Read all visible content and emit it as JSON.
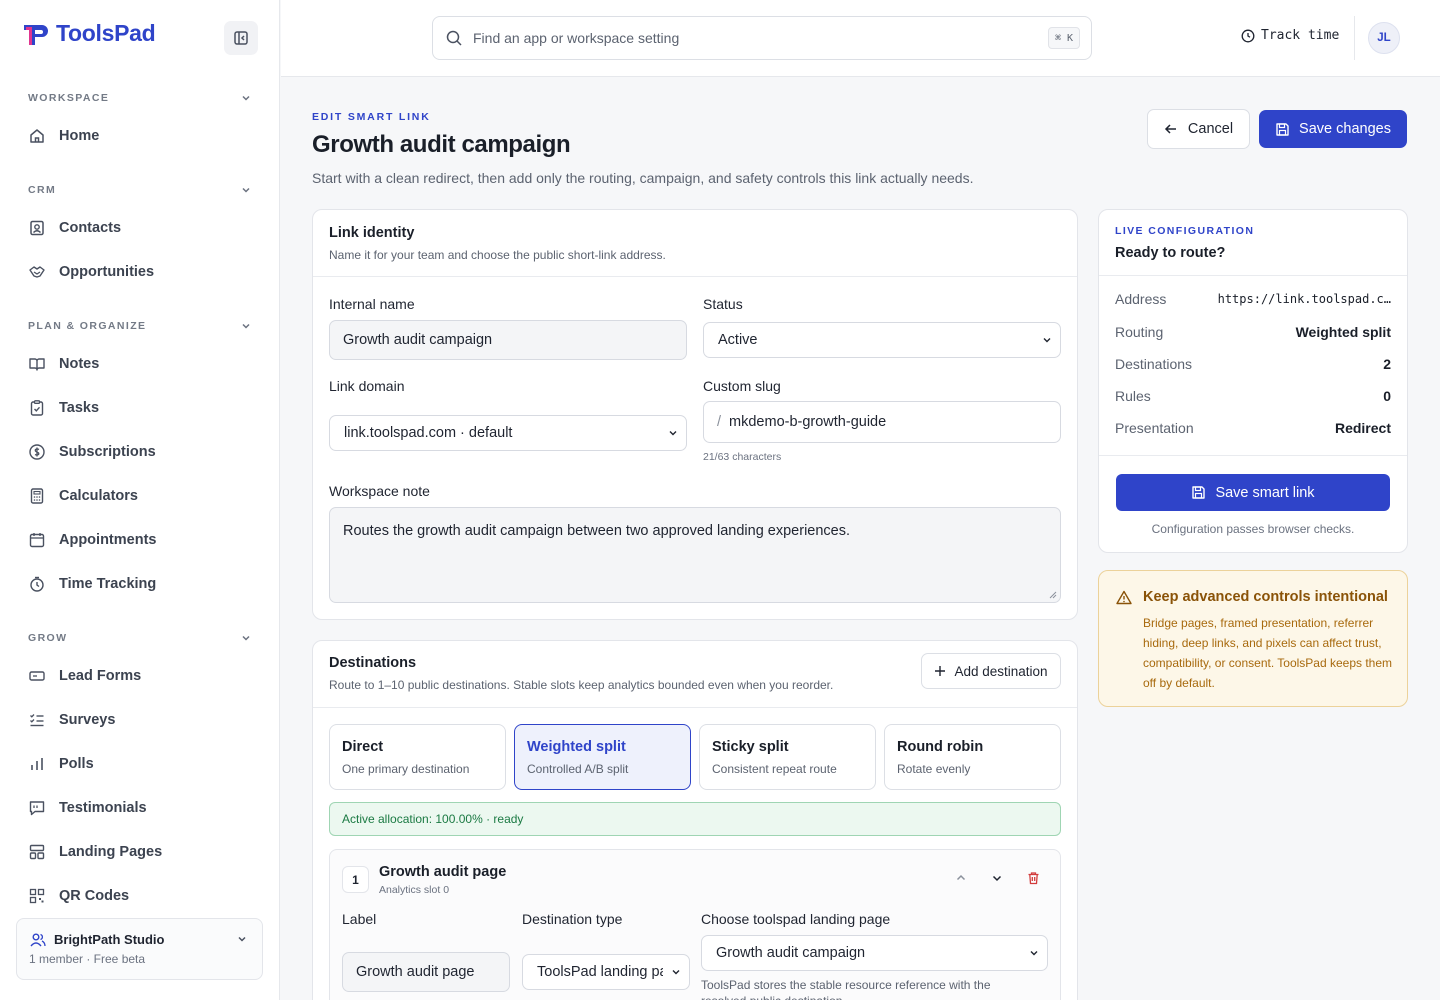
{
  "app": {
    "name": "ToolsPad",
    "brand_color": "#2f44c9"
  },
  "sidebar": {
    "sections": [
      {
        "label": "WORKSPACE",
        "items": [
          {
            "label": "Home",
            "icon": "home-icon"
          }
        ]
      },
      {
        "label": "CRM",
        "items": [
          {
            "label": "Contacts",
            "icon": "contact-card-icon"
          },
          {
            "label": "Opportunities",
            "icon": "handshake-icon"
          }
        ]
      },
      {
        "label": "PLAN & ORGANIZE",
        "items": [
          {
            "label": "Notes",
            "icon": "book-icon"
          },
          {
            "label": "Tasks",
            "icon": "clipboard-check-icon"
          },
          {
            "label": "Subscriptions",
            "icon": "dollar-circle-icon"
          },
          {
            "label": "Calculators",
            "icon": "calculator-icon"
          },
          {
            "label": "Appointments",
            "icon": "calendar-icon"
          },
          {
            "label": "Time Tracking",
            "icon": "stopwatch-icon"
          }
        ]
      },
      {
        "label": "GROW",
        "items": [
          {
            "label": "Lead Forms",
            "icon": "form-icon"
          },
          {
            "label": "Surveys",
            "icon": "checklist-icon"
          },
          {
            "label": "Polls",
            "icon": "bar-chart-icon"
          },
          {
            "label": "Testimonials",
            "icon": "message-square-icon"
          },
          {
            "label": "Landing Pages",
            "icon": "layout-icon"
          },
          {
            "label": "QR Codes",
            "icon": "qr-code-icon"
          }
        ]
      }
    ],
    "workspace": {
      "name": "BrightPath Studio",
      "meta": "1 member · Free beta"
    }
  },
  "topbar": {
    "search_placeholder": "Find an app or workspace setting",
    "shortcut": "⌘ K",
    "track_time": "Track time",
    "avatar_initials": "JL"
  },
  "page": {
    "eyebrow": "EDIT SMART LINK",
    "title": "Growth audit campaign",
    "subtitle": "Start with a clean redirect, then add only the routing, campaign, and safety controls this link actually needs.",
    "cancel_label": "Cancel",
    "save_label": "Save changes"
  },
  "identity": {
    "title": "Link identity",
    "desc": "Name it for your team and choose the public short-link address.",
    "internal_name_label": "Internal name",
    "internal_name_value": "Growth audit campaign",
    "status_label": "Status",
    "status_value": "Active",
    "domain_label": "Link domain",
    "domain_value": "link.toolspad.com · default",
    "slug_label": "Custom slug",
    "slug_prefix": "/",
    "slug_value": "mkdemo-b-growth-guide",
    "slug_hint": "21/63 characters",
    "note_label": "Workspace note",
    "note_value": "Routes the growth audit campaign between two approved landing experiences."
  },
  "destinations": {
    "title": "Destinations",
    "desc": "Route to 1–10 public destinations. Stable slots keep analytics bounded even when you reorder.",
    "add_label": "Add destination",
    "modes": [
      {
        "title": "Direct",
        "desc": "One primary destination"
      },
      {
        "title": "Weighted split",
        "desc": "Controlled A/B split"
      },
      {
        "title": "Sticky split",
        "desc": "Consistent repeat route"
      },
      {
        "title": "Round robin",
        "desc": "Rotate evenly"
      }
    ],
    "active_mode": "Weighted split",
    "allocation": "Active allocation: 100.00% · ready",
    "item": {
      "number": "1",
      "title": "Growth audit page",
      "slot": "Analytics slot 0",
      "label_label": "Label",
      "label_value": "Growth audit page",
      "type_label": "Destination type",
      "type_value": "ToolsPad landing page",
      "choose_label": "Choose toolspad landing page",
      "choose_value": "Growth audit campaign",
      "choose_hint": "ToolsPad stores the stable resource reference with the resolved public destination."
    }
  },
  "live": {
    "eyebrow": "LIVE CONFIGURATION",
    "title": "Ready to route?",
    "rows": [
      {
        "key": "Address",
        "value": "https://link.toolspad.c…"
      },
      {
        "key": "Routing",
        "value": "Weighted split"
      },
      {
        "key": "Destinations",
        "value": "2"
      },
      {
        "key": "Rules",
        "value": "0"
      },
      {
        "key": "Presentation",
        "value": "Redirect"
      }
    ],
    "save_label": "Save smart link",
    "note": "Configuration passes browser checks."
  },
  "warning": {
    "title": "Keep advanced controls intentional",
    "body": "Bridge pages, framed presentation, referrer hiding, deep links, and pixels can affect trust, compatibility, or consent. ToolsPad keeps them off by default."
  }
}
